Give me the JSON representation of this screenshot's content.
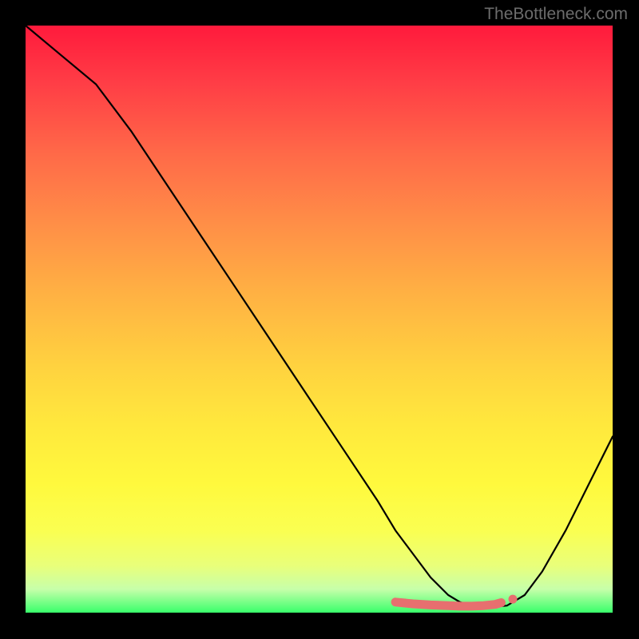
{
  "watermark": "TheBottleneck.com",
  "chart_data": {
    "type": "line",
    "title": "",
    "xlabel": "",
    "ylabel": "",
    "xlim": [
      0,
      100
    ],
    "ylim": [
      0,
      100
    ],
    "series": [
      {
        "name": "bottleneck-curve",
        "x": [
          0,
          6,
          12,
          18,
          24,
          30,
          36,
          42,
          48,
          54,
          60,
          63,
          66,
          69,
          72,
          74,
          76,
          78,
          80,
          82,
          85,
          88,
          92,
          96,
          100
        ],
        "values": [
          100,
          95,
          90,
          82,
          73,
          64,
          55,
          46,
          37,
          28,
          19,
          14,
          10,
          6,
          3,
          1.8,
          1.2,
          1.0,
          1.0,
          1.2,
          3,
          7,
          14,
          22,
          30
        ]
      }
    ],
    "highlight_segment": {
      "x": [
        63,
        66,
        69,
        72,
        74,
        76,
        78,
        80,
        81
      ],
      "values": [
        1.8,
        1.5,
        1.3,
        1.2,
        1.1,
        1.1,
        1.2,
        1.4,
        1.7
      ]
    },
    "highlight_dot": {
      "x": 83,
      "value": 2.3
    }
  }
}
